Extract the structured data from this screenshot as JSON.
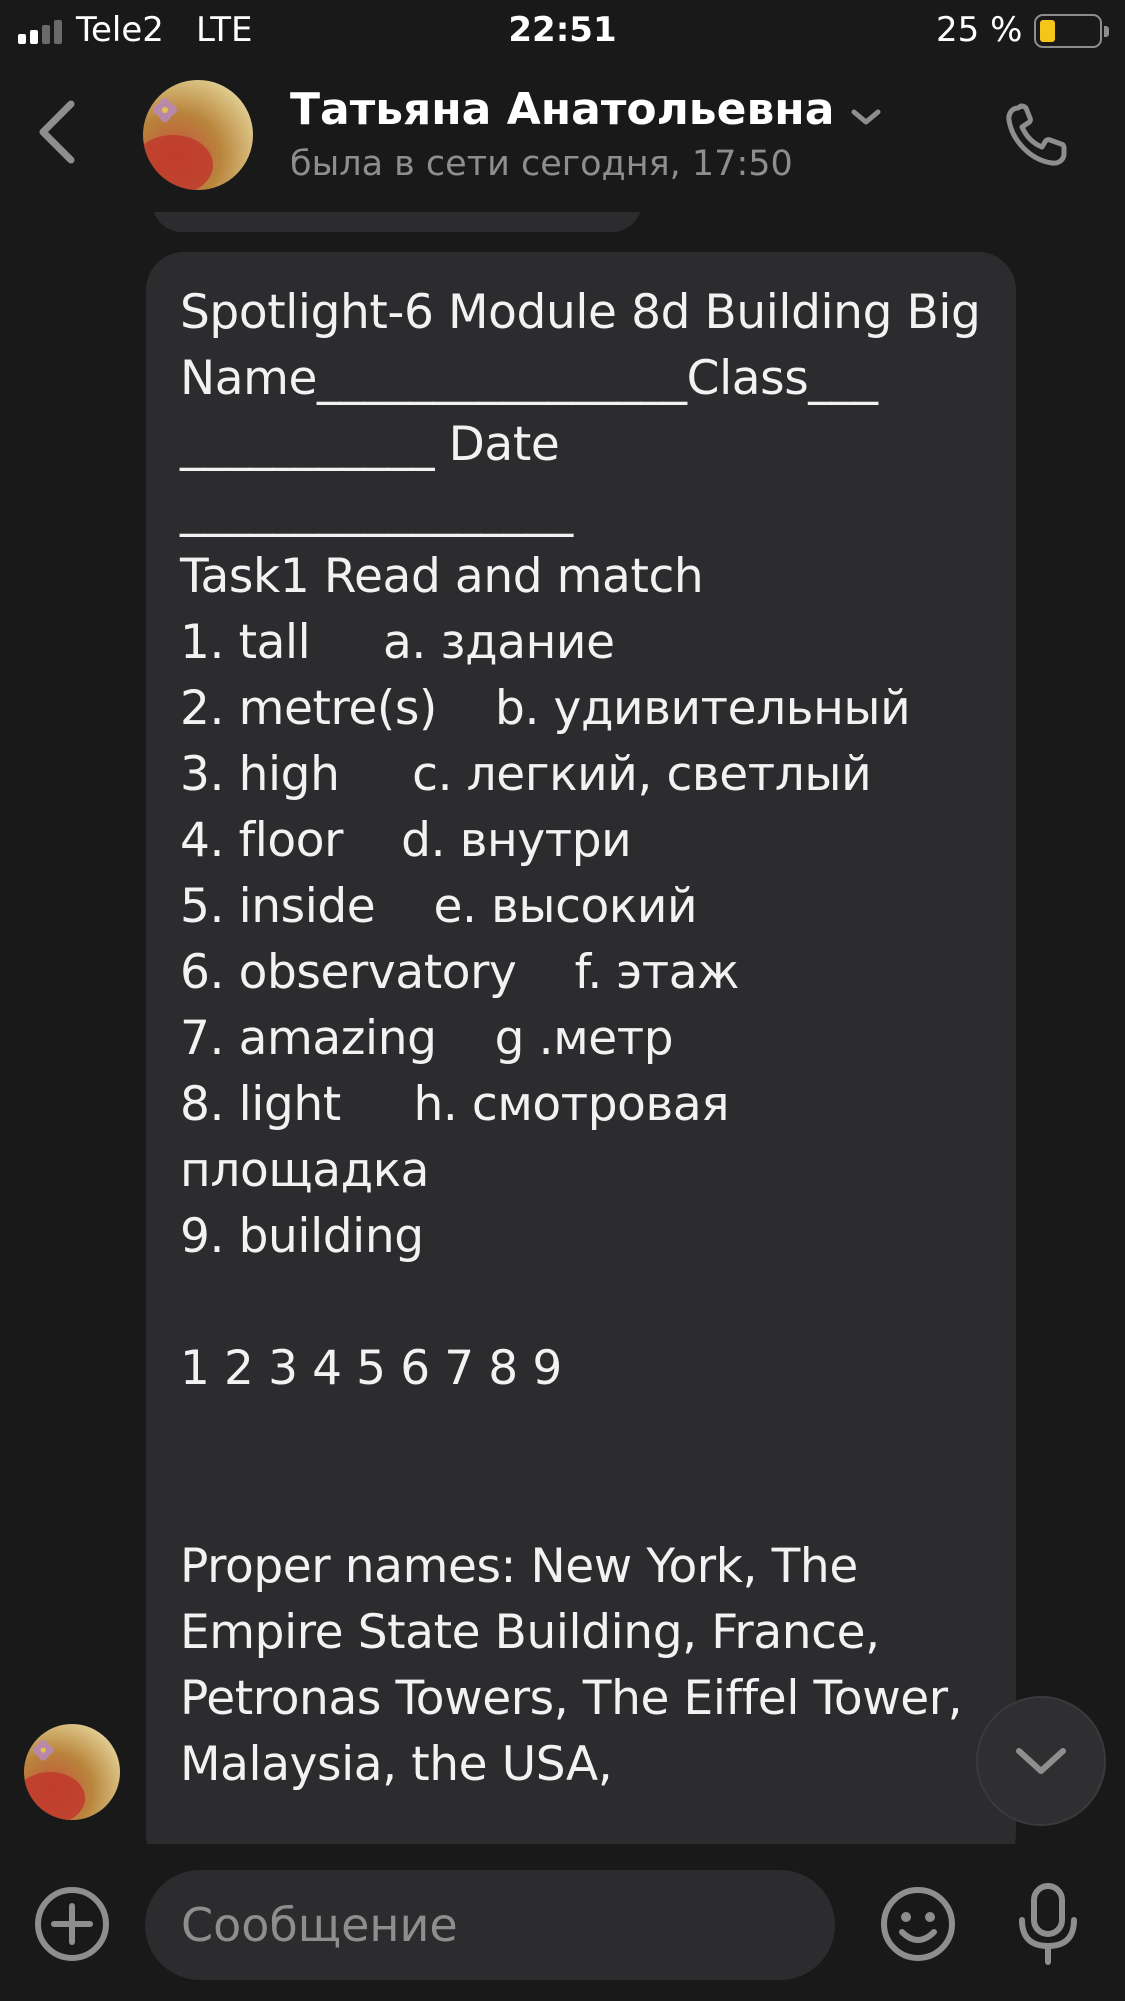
{
  "status_bar": {
    "carrier": "Tele2",
    "network": "LTE",
    "time": "22:51",
    "battery": "25 %",
    "battery_level": 0.25,
    "battery_color": "#f5c518"
  },
  "header": {
    "contact_name": "Татьяна Анатольевна",
    "last_seen": "была в сети сегодня, 17:50",
    "icons": [
      "chevron-left-icon",
      "avatar",
      "chevron-down-icon",
      "phone-icon"
    ]
  },
  "message": {
    "text": "Spotlight-6 Module 8d Building Big\nName________________Class___\n___________ Date\n_________________\nTask1 Read and match\n1. tall     a. здание\n2. metre(s)    b. удивительный\n3. high     c. легкий, светлый\n4. floor    d. внутри\n5. inside    e. высокий\n6. observatory    f. этаж\n7. amazing    g .метр\n8. light     h. смотровая площадка\n9. building\n\n1 2 3 4 5 6 7 8 9\n\n\nProper names: New York, The Empire State Building, France, Petronas Towers, The Eiffel Tower, Malaysia, the USA,"
  },
  "composer": {
    "placeholder": "Сообщение",
    "icons": [
      "plus-circle-icon",
      "emoji-icon",
      "microphone-icon"
    ]
  },
  "colors": {
    "background": "#191919",
    "bubble": "#2c2c2e",
    "secondary_text": "#8e8e8e"
  }
}
